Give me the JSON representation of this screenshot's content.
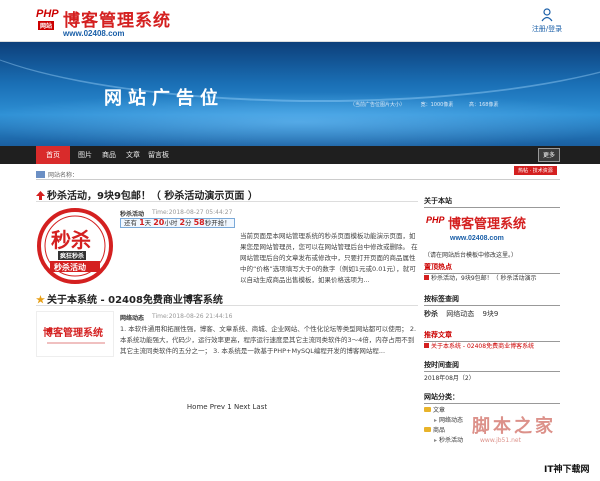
{
  "header": {
    "logo_php": "PHP",
    "logo_badge": "网站",
    "logo_title": "博客管理系统",
    "logo_site": "www.02408.com",
    "login_label": "注册/登录"
  },
  "banner": {
    "title": "网站广告位",
    "meta": [
      "（当前广告位图片大小）",
      "宽：1000像素",
      "高：168像素"
    ]
  },
  "nav": {
    "items": [
      "首页",
      "图片",
      "商品",
      "文章",
      "留言板"
    ],
    "more": "更多"
  },
  "crumb": {
    "label": "网站名称：",
    "flag": "热帖 · 技术资源"
  },
  "articles": [
    {
      "title": "秒杀活动，9块9包邮！（ 秒杀活动演示页面 ）",
      "category": "秒杀活动",
      "time": "Time:2018-08-27 05:44:27",
      "thumb_main": "秒杀",
      "thumb_badge": "疯狂秒杀",
      "thumb_sub": "秒杀活动",
      "countdown": {
        "prefix": "还有",
        "days": "1",
        "d_unit": "天",
        "hours": "20",
        "h_unit": "小时",
        "minutes": "2",
        "m_unit": "分",
        "seconds": "58",
        "s_unit": "秒开抢！"
      },
      "desc": "当前页面是本网站管理系统的秒杀页面模板功能演示页面，如果您是网站管理员，您可以在网站管理后台中修改或删除。 在网站管理后台的文章发布或修改中，只要打开页面的商品属性中的“价格”选项填写大于0的数字（例如1元或0.01元），就可以自动生成商品出售模板，如果价格选项为..."
    },
    {
      "title": "关于本系统 - 02408免费商业博客系统",
      "category": "网络动态",
      "time": "Time:2018-08-26 21:44:16",
      "thumb_title": "博客管理系统",
      "desc": "1. 本软件通用和拓展性强，博客、文章系统、商城、企业网站、个性化论坛等类型网站都可以使用； 2. 本系统功能强大，代码少，运行效率更高，程序运行速度是其它主流同类软件的3～4倍，内存占用不到其它主流同类软件的五分之一； 3. 本系统是一款基于PHP+MySQL编程开发的博客网站程..."
    }
  ],
  "pager": "Home Prev 1 Next Last",
  "sidebar": {
    "about_head": "关于本站",
    "about_logo_title": "博客管理系统",
    "about_logo_site": "www.02408.com",
    "about_note": "（请在网站后台模板中修改这里。）",
    "top_head": "置顶热点",
    "top_item": "秒杀活动，9块9包邮！（ 秒杀活动演示",
    "tag_head": "按标签查阅",
    "tags": [
      "秒杀",
      "网络动态",
      "9块9"
    ],
    "rec_head": "推荐文章",
    "rec_item": "关于本系统 - 02408免费商业博客系统",
    "date_head": "按时间查阅",
    "date_item": "2018年08月（2）",
    "cat_head": "网站分类：",
    "cats": [
      "文章",
      "网络动态",
      "商品",
      "秒杀活动"
    ]
  },
  "watermark": "脚本之家",
  "watermark_url": "www.jb51.net",
  "corner_mark": "IT神下载网"
}
